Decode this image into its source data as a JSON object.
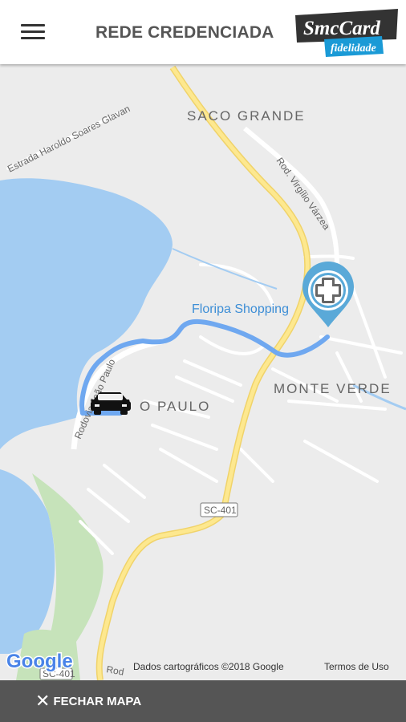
{
  "header": {
    "title": "REDE CREDENCIADA",
    "menu_icon": "hamburger-menu-icon",
    "logo": {
      "main": "SmcCard",
      "sub": "fidelidade",
      "colors": [
        "#333333",
        "#1a9ad6"
      ]
    }
  },
  "map": {
    "areas": [
      "SACO GRANDE",
      "MONTE VERDE",
      "O PAULO"
    ],
    "roads": [
      "Estrada Haroldo Soares Glavan",
      "Rod. Virgílio Várzea",
      "Rodovia João Paulo",
      "SC-401",
      "SC-401",
      "Rod"
    ],
    "poi": "Floripa Shopping",
    "destination_icon": "hospital-cross-pin-icon",
    "origin_icon": "car-icon",
    "route_color": "#6fa8f0",
    "google_logo": "Google",
    "attribution": "Dados cartográficos ©2018 Google",
    "terms": "Termos de Uso"
  },
  "footer": {
    "close_label": "FECHAR MAPA",
    "close_icon": "close-icon"
  }
}
